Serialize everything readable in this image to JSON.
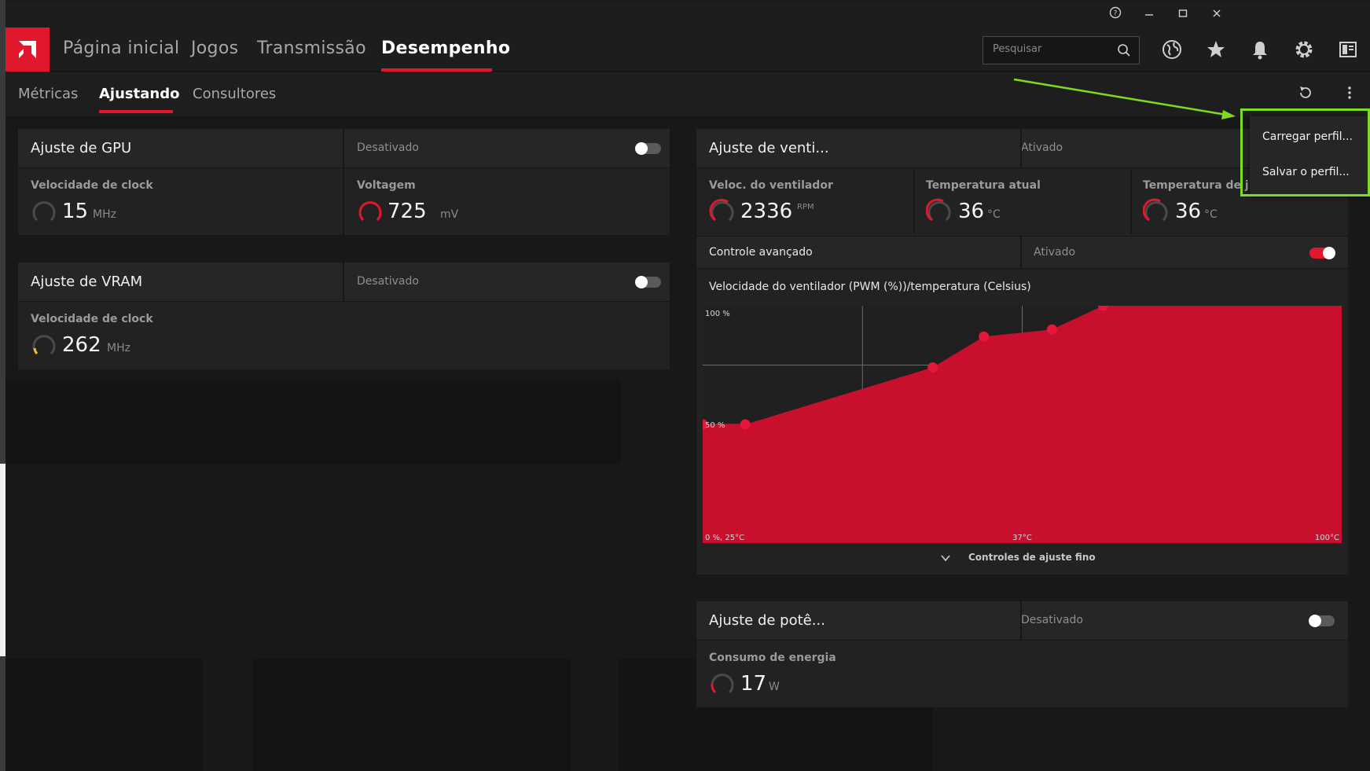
{
  "nav": {
    "items": [
      "Página inicial",
      "Jogos",
      "Transmissão",
      "Desempenho"
    ],
    "active": "Desempenho"
  },
  "search": {
    "placeholder": "Pesquisar"
  },
  "subnav": {
    "items": [
      "Métricas",
      "Ajustando",
      "Consultores"
    ],
    "active": "Ajustando"
  },
  "gpu": {
    "title": "Ajuste de GPU",
    "state": "Desativado",
    "clock_label": "Velocidade de clock",
    "clock_value": "15",
    "clock_unit": "MHz",
    "voltage_label": "Voltagem",
    "voltage_value": "725",
    "voltage_unit": "mV"
  },
  "vram": {
    "title": "Ajuste de VRAM",
    "state": "Desativado",
    "clock_label": "Velocidade de clock",
    "clock_value": "262",
    "clock_unit": "MHz"
  },
  "fan": {
    "title": "Ajuste de venti...",
    "state": "Ativado",
    "speed_label": "Veloc. do ventilador",
    "speed_value": "2336",
    "speed_unit": "RPM",
    "temp_label": "Temperatura atual",
    "temp_value": "36",
    "temp_unit": "°C",
    "junction_label": "Temperatura de j",
    "junction_value": "36",
    "junction_unit": "°C",
    "advanced_label": "Controle avançado",
    "advanced_state": "Ativado",
    "curve_title": "Velocidade do ventilador (PWM (%))/temperatura (Celsius)",
    "fine_tune_label": "Controles de ajuste fino"
  },
  "power": {
    "title": "Ajuste de potê...",
    "state": "Desativado",
    "consumption_label": "Consumo de energia",
    "consumption_value": "17",
    "consumption_unit": "W"
  },
  "menu": {
    "items": [
      "Carregar perfil...",
      "Salvar o perfil..."
    ]
  },
  "chart_data": {
    "type": "area",
    "title": "Velocidade do ventilador (PWM (%))/temperatura (Celsius)",
    "y_tick_labels": [
      "100 %",
      "50 %",
      "0 %, 25°C"
    ],
    "x_tick_labels": [
      "37°C",
      "100°C"
    ],
    "xlim": [
      25,
      100
    ],
    "ylim": [
      0,
      100
    ],
    "x": [
      25,
      30,
      52,
      58,
      66,
      72
    ],
    "values": [
      50,
      50,
      74,
      87,
      90,
      100
    ],
    "colors": {
      "fill": "#c8102e",
      "point": "#e8173a",
      "grid": "#6a6a6a"
    }
  },
  "colors": {
    "accent": "#e1182c",
    "highlight": "#7ddc1f"
  }
}
